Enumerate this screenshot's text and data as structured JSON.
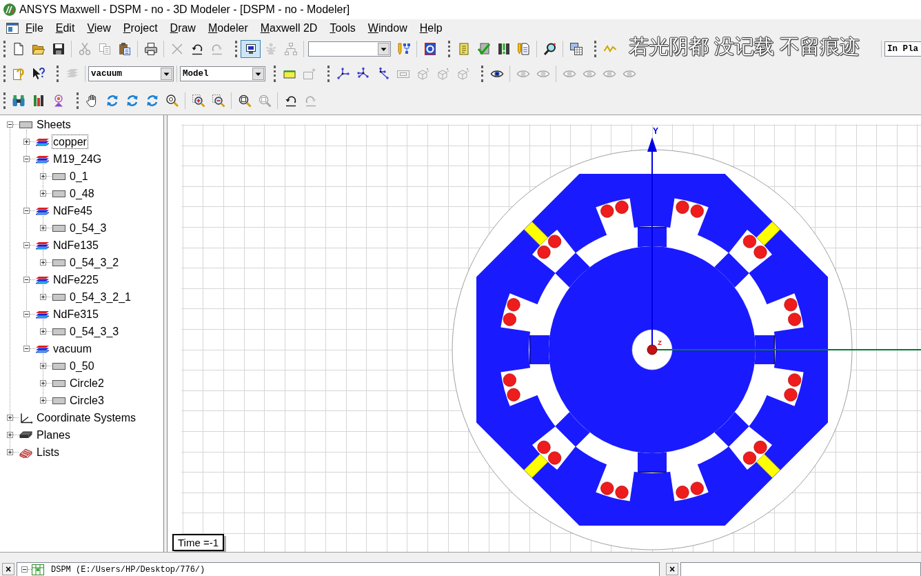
{
  "window": {
    "title": "ANSYS Maxwell - DSPM - no - 3D Modeler - [DSPM - no - Modeler]"
  },
  "menu": [
    "File",
    "Edit",
    "View",
    "Project",
    "Draw",
    "Modeler",
    "Maxwell 2D",
    "Tools",
    "Window",
    "Help"
  ],
  "toolbars": [
    {
      "items": [
        {
          "kind": "grip"
        },
        {
          "kind": "button",
          "disabled": false,
          "pressed": false
        },
        {
          "kind": "button",
          "disabled": false,
          "pressed": false
        },
        {
          "kind": "button",
          "disabled": false,
          "pressed": false
        },
        {
          "kind": "separator"
        },
        {
          "kind": "button",
          "disabled": true,
          "pressed": false
        },
        {
          "kind": "button",
          "disabled": true,
          "pressed": false
        },
        {
          "kind": "button",
          "disabled": false,
          "pressed": false
        },
        {
          "kind": "separator"
        },
        {
          "kind": "button",
          "disabled": false,
          "pressed": false
        },
        {
          "kind": "separator"
        },
        {
          "kind": "button",
          "disabled": true,
          "pressed": false
        },
        {
          "kind": "button",
          "disabled": false,
          "pressed": false
        },
        {
          "kind": "button",
          "disabled": true,
          "pressed": false
        },
        {
          "kind": "grip"
        },
        {
          "kind": "button",
          "disabled": false,
          "pressed": true
        },
        {
          "kind": "button",
          "disabled": true,
          "pressed": false
        },
        {
          "kind": "button",
          "disabled": true,
          "pressed": false
        },
        {
          "kind": "separator"
        },
        {
          "kind": "dropdown"
        },
        {
          "kind": "button",
          "disabled": false,
          "pressed": false
        },
        {
          "kind": "separator"
        },
        {
          "kind": "button",
          "disabled": false,
          "pressed": false
        },
        {
          "kind": "grip"
        },
        {
          "kind": "button",
          "disabled": false,
          "pressed": false
        },
        {
          "kind": "button",
          "disabled": false,
          "pressed": false
        },
        {
          "kind": "button",
          "disabled": false,
          "pressed": false
        },
        {
          "kind": "button",
          "disabled": false,
          "pressed": false
        },
        {
          "kind": "separator"
        },
        {
          "kind": "button",
          "disabled": false,
          "pressed": false
        },
        {
          "kind": "separator"
        },
        {
          "kind": "button",
          "disabled": false,
          "pressed": false
        },
        {
          "kind": "grip"
        },
        {
          "kind": "button",
          "disabled": false,
          "pressed": false
        },
        {
          "kind": "separator"
        },
        {
          "kind": "dropdown",
          "value": "In Pla"
        }
      ]
    },
    {
      "items": [
        {
          "kind": "grip"
        },
        {
          "kind": "button",
          "disabled": false,
          "pressed": false
        },
        {
          "kind": "button",
          "disabled": false,
          "pressed": false
        },
        {
          "kind": "grip"
        },
        {
          "kind": "button",
          "disabled": true,
          "pressed": false
        },
        {
          "kind": "separator"
        },
        {
          "kind": "dropdown",
          "value": "vacuum"
        },
        {
          "kind": "separator"
        },
        {
          "kind": "dropdown",
          "value": "Model"
        },
        {
          "kind": "grip"
        },
        {
          "kind": "button",
          "disabled": false,
          "pressed": false
        },
        {
          "kind": "button",
          "disabled": true,
          "pressed": false
        },
        {
          "kind": "grip"
        },
        {
          "kind": "button",
          "disabled": false,
          "pressed": false
        },
        {
          "kind": "button",
          "disabled": false,
          "pressed": false
        },
        {
          "kind": "button",
          "disabled": false,
          "pressed": false
        },
        {
          "kind": "button",
          "disabled": true,
          "pressed": false
        },
        {
          "kind": "button",
          "disabled": true,
          "pressed": false
        },
        {
          "kind": "button",
          "disabled": true,
          "pressed": false
        },
        {
          "kind": "button",
          "disabled": true,
          "pressed": false
        },
        {
          "kind": "grip"
        },
        {
          "kind": "button",
          "disabled": false,
          "pressed": false
        },
        {
          "kind": "separator"
        },
        {
          "kind": "button",
          "disabled": true,
          "pressed": false
        },
        {
          "kind": "button",
          "disabled": true,
          "pressed": false
        },
        {
          "kind": "separator"
        },
        {
          "kind": "button",
          "disabled": true,
          "pressed": false
        },
        {
          "kind": "button",
          "disabled": true,
          "pressed": false
        },
        {
          "kind": "button",
          "disabled": true,
          "pressed": false
        },
        {
          "kind": "button",
          "disabled": true,
          "pressed": false
        }
      ]
    },
    {
      "items": [
        {
          "kind": "grip"
        },
        {
          "kind": "button",
          "disabled": false,
          "pressed": false
        },
        {
          "kind": "button",
          "disabled": false,
          "pressed": false
        },
        {
          "kind": "button",
          "disabled": false,
          "pressed": false
        },
        {
          "kind": "grip"
        },
        {
          "kind": "button",
          "disabled": false,
          "pressed": false
        },
        {
          "kind": "button",
          "disabled": false,
          "pressed": false
        },
        {
          "kind": "button",
          "disabled": false,
          "pressed": false
        },
        {
          "kind": "button",
          "disabled": false,
          "pressed": false
        },
        {
          "kind": "button",
          "disabled": false,
          "pressed": false
        },
        {
          "kind": "separator"
        },
        {
          "kind": "button",
          "disabled": false,
          "pressed": false
        },
        {
          "kind": "button",
          "disabled": false,
          "pressed": false
        },
        {
          "kind": "separator"
        },
        {
          "kind": "button",
          "disabled": false,
          "pressed": false
        },
        {
          "kind": "button",
          "disabled": true,
          "pressed": false
        },
        {
          "kind": "separator"
        },
        {
          "kind": "button",
          "disabled": false,
          "pressed": false
        },
        {
          "kind": "button",
          "disabled": true,
          "pressed": false
        }
      ]
    }
  ],
  "subtitle_caption": "若光阴都 没记载 不留痕迹",
  "project_tree": [
    {
      "label": "Sheets",
      "kind": "sheet",
      "expanded": true,
      "selected": false,
      "children": [
        {
          "label": "copper",
          "kind": "material",
          "expanded": false,
          "selected": true
        },
        {
          "label": "M19_24G",
          "kind": "material",
          "expanded": true,
          "selected": false,
          "children": [
            {
              "label": "0_1",
              "kind": "sheet",
              "expanded": false,
              "selected": false
            },
            {
              "label": "0_48",
              "kind": "sheet",
              "expanded": false,
              "selected": false
            }
          ]
        },
        {
          "label": "NdFe45",
          "kind": "material",
          "expanded": true,
          "selected": false,
          "children": [
            {
              "label": "0_54_3",
              "kind": "sheet",
              "expanded": false,
              "selected": false
            }
          ]
        },
        {
          "label": "NdFe135",
          "kind": "material",
          "expanded": true,
          "selected": false,
          "children": [
            {
              "label": "0_54_3_2",
              "kind": "sheet",
              "expanded": false,
              "selected": false
            }
          ]
        },
        {
          "label": "NdFe225",
          "kind": "material",
          "expanded": true,
          "selected": false,
          "children": [
            {
              "label": "0_54_3_2_1",
              "kind": "sheet",
              "expanded": false,
              "selected": false
            }
          ]
        },
        {
          "label": "NdFe315",
          "kind": "material",
          "expanded": true,
          "selected": false,
          "children": [
            {
              "label": "0_54_3_3",
              "kind": "sheet",
              "expanded": false,
              "selected": false
            }
          ]
        },
        {
          "label": "vacuum",
          "kind": "material",
          "expanded": true,
          "selected": false,
          "children": [
            {
              "label": "0_50",
              "kind": "sheet",
              "expanded": false,
              "selected": false
            },
            {
              "label": "Circle2",
              "kind": "sheet",
              "expanded": false,
              "selected": false
            },
            {
              "label": "Circle3",
              "kind": "sheet",
              "expanded": false,
              "selected": false
            }
          ]
        }
      ]
    },
    {
      "label": "Coordinate Systems",
      "kind": "coordinate-systems",
      "expanded": false,
      "selected": false
    },
    {
      "label": "Planes",
      "kind": "planes",
      "expanded": false,
      "selected": false
    },
    {
      "label": "Lists",
      "kind": "lists",
      "expanded": false,
      "selected": false
    }
  ],
  "viewport": {
    "y_axis_label": "Y",
    "z_axis_label": "Z",
    "time_label": "Time =-1"
  },
  "bottom_panels": [
    {
      "close_label": "×",
      "items": [
        {
          "label": "DSPM (E:/Users/HP/Desktop/776/)",
          "expanded": true
        }
      ]
    },
    {
      "close_label": "×"
    }
  ]
}
